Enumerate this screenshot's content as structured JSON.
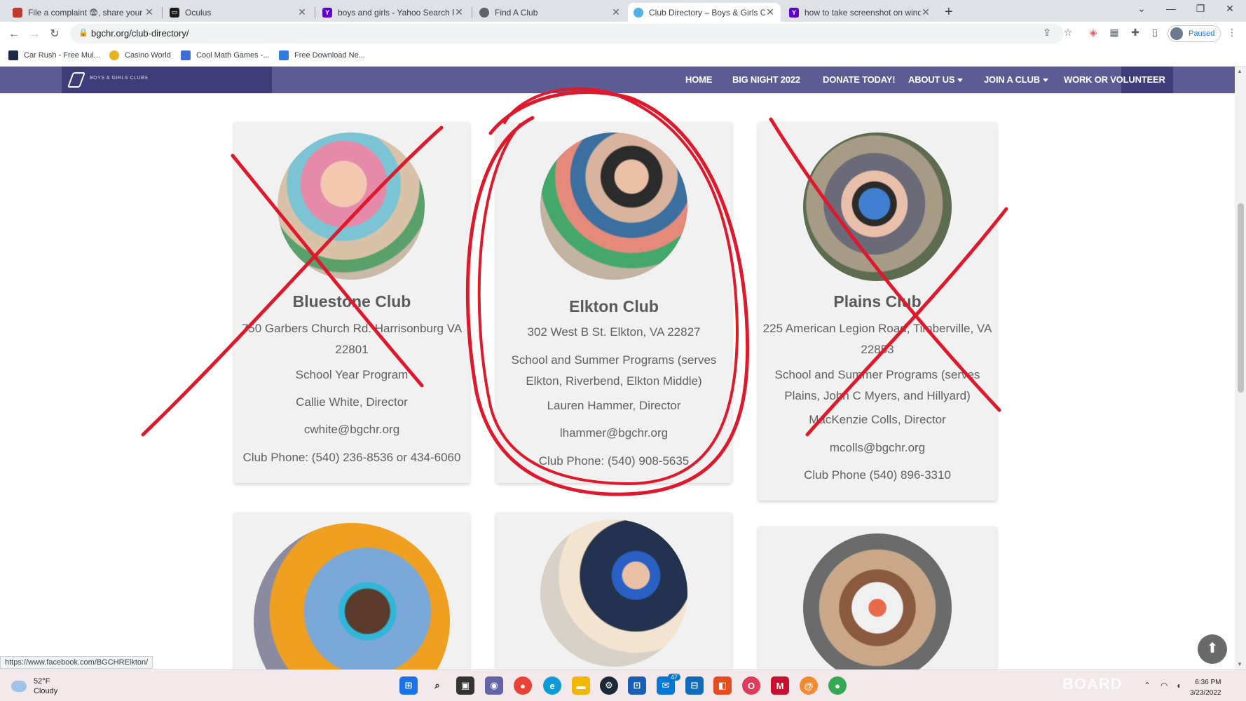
{
  "browser": {
    "tabs": [
      {
        "title": "File a complaint 😨, share your e",
        "favicon_color": "#c0392b"
      },
      {
        "title": "Oculus",
        "favicon_color": "#1c1c1c"
      },
      {
        "title": "boys and girls - Yahoo Search Re",
        "favicon_color": "#6001d2"
      },
      {
        "title": "Find A Club",
        "favicon_color": "#5f6368"
      },
      {
        "title": "Club Directory – Boys & Girls Clu",
        "favicon_color": "#4fb3e8"
      },
      {
        "title": "how to take screenshot on windo",
        "favicon_color": "#6001d2"
      }
    ],
    "url": "bgchr.org/club-directory/",
    "profile_label": "Paused",
    "bookmarks": [
      "Car Rush - Free Mul...",
      "Casino World",
      "Cool Math Games -...",
      "Free Download Ne..."
    ],
    "status_url": "https://www.facebook.com/BGCHRElkton/"
  },
  "site": {
    "nav": [
      "HOME",
      "BIG NIGHT 2022",
      "DONATE TODAY!",
      "ABOUT US",
      "JOIN A CLUB",
      "WORK OR VOLUNTEER"
    ],
    "accent": "#5d5b93",
    "annotation_color": "#e0182b"
  },
  "clubs": [
    {
      "name": "Bluestone Club",
      "address": "750 Garbers Church Rd. Harrisonburg VA 22801",
      "program": "School Year Program",
      "director": "Callie White, Director",
      "email": "cwhite@bgchr.org",
      "phone": "Club Phone: (540) 236-8536  or 434-6060"
    },
    {
      "name": "Elkton Club",
      "address": "302 West B St. Elkton, VA 22827",
      "program": "School and Summer Programs (serves Elkton, Riverbend, Elkton Middle)",
      "director": "Lauren Hammer, Director",
      "email": "lhammer@bgchr.org",
      "phone": "Club Phone: (540) 908-5635"
    },
    {
      "name": "Plains Club",
      "address": "225 American Legion Road, Timberville, VA 22853",
      "program": "School and Summer Programs (serves Plains, John C Myers, and Hillyard)",
      "director": "MacKenzie Colls, Director",
      "email": "mcolls@bgchr.org",
      "phone": "Club Phone (540) 896-3310"
    }
  ],
  "taskbar": {
    "temperature": "52°F",
    "condition": "Cloudy",
    "time": "6:36 PM",
    "date": "3/23/2022",
    "mail_badge": "47",
    "watermark": "BOARD"
  }
}
